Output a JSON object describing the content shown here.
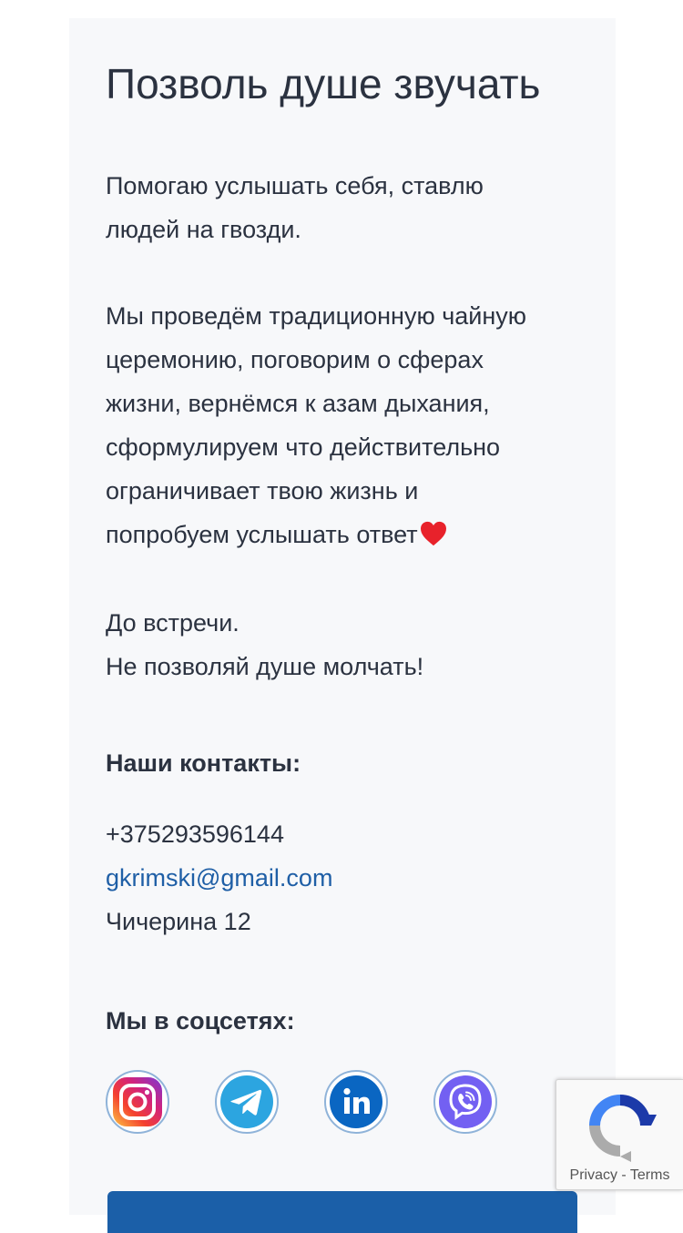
{
  "header": {
    "title": "Позволь душе звучать"
  },
  "intro": {
    "lines": [
      "Помогаю услышать себя, ставлю",
      "людей на гвозди."
    ]
  },
  "ceremony": {
    "lines": [
      "Мы проведём традиционную чайную",
      "церемонию, поговорим о сферах",
      "жизни, вернёмся к азам дыхания,",
      "сформулируем что действительно",
      "ограничивает твою жизнь и",
      "попробуем услышать ответ"
    ],
    "emoji": "heart-icon"
  },
  "farewell": {
    "lines": [
      "До встречи.",
      "Не позволяй душе молчать!"
    ]
  },
  "contacts": {
    "heading": "Наши контакты:",
    "phone": "+375293596144",
    "email": "gkrimski@gmail.com",
    "address": "Чичерина 12"
  },
  "socials": {
    "heading": "Мы в соцсетях:",
    "items": [
      {
        "icon": "instagram-icon"
      },
      {
        "icon": "telegram-icon"
      },
      {
        "icon": "linkedin-icon"
      },
      {
        "icon": "viber-icon"
      }
    ]
  },
  "recaptcha": {
    "privacy": "Privacy",
    "separator": " - ",
    "terms": "Terms"
  },
  "colors": {
    "text": "#2b3240",
    "link": "#1f5fa6",
    "card_bg": "#f7f8fa",
    "cta": "#1b5fa8",
    "icon_border": "#8fb3d9"
  }
}
